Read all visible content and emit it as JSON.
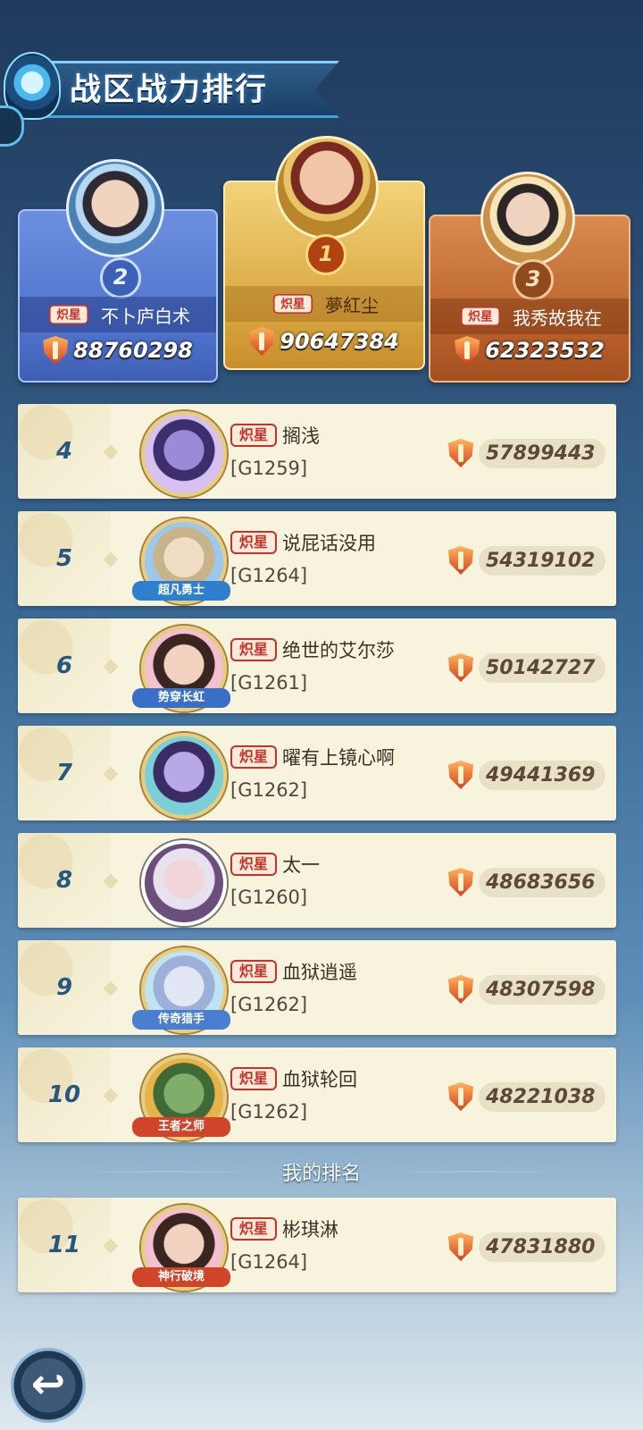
{
  "header": {
    "title": "战区战力排行"
  },
  "title_badge": "炽星",
  "podium": [
    {
      "rank": "1",
      "name": "夢紅尘",
      "power": "90647384"
    },
    {
      "rank": "2",
      "name": "不卜庐白术",
      "power": "88760298"
    },
    {
      "rank": "3",
      "name": "我秀故我在",
      "power": "62323532"
    }
  ],
  "rows": [
    {
      "rank": "4",
      "name": "搁浅",
      "server": "[G1259]",
      "power": "57899443",
      "frame_label": ""
    },
    {
      "rank": "5",
      "name": "说屁话没用",
      "server": "[G1264]",
      "power": "54319102",
      "frame_label": "超凡勇士"
    },
    {
      "rank": "6",
      "name": "绝世的艾尔莎",
      "server": "[G1261]",
      "power": "50142727",
      "frame_label": "势穿长虹"
    },
    {
      "rank": "7",
      "name": "曜有上镜心啊",
      "server": "[G1262]",
      "power": "49441369",
      "frame_label": ""
    },
    {
      "rank": "8",
      "name": "太一",
      "server": "[G1260]",
      "power": "48683656",
      "frame_label": ""
    },
    {
      "rank": "9",
      "name": "血狱逍遥",
      "server": "[G1262]",
      "power": "48307598",
      "frame_label": "传奇猎手"
    },
    {
      "rank": "10",
      "name": "血狱轮回",
      "server": "[G1262]",
      "power": "48221038",
      "frame_label": "王者之师"
    }
  ],
  "my_rank": {
    "label": "我的排名",
    "rank": "11",
    "name": "彬琪淋",
    "server": "[G1264]",
    "power": "47831880",
    "frame_label": "神行破境"
  },
  "colors": {
    "accent": "#26587f",
    "badge": "#c6332a",
    "row_bg": "#f7f3dc"
  },
  "icons": {
    "power": "shield-icon",
    "back": "back-arrow-icon"
  }
}
